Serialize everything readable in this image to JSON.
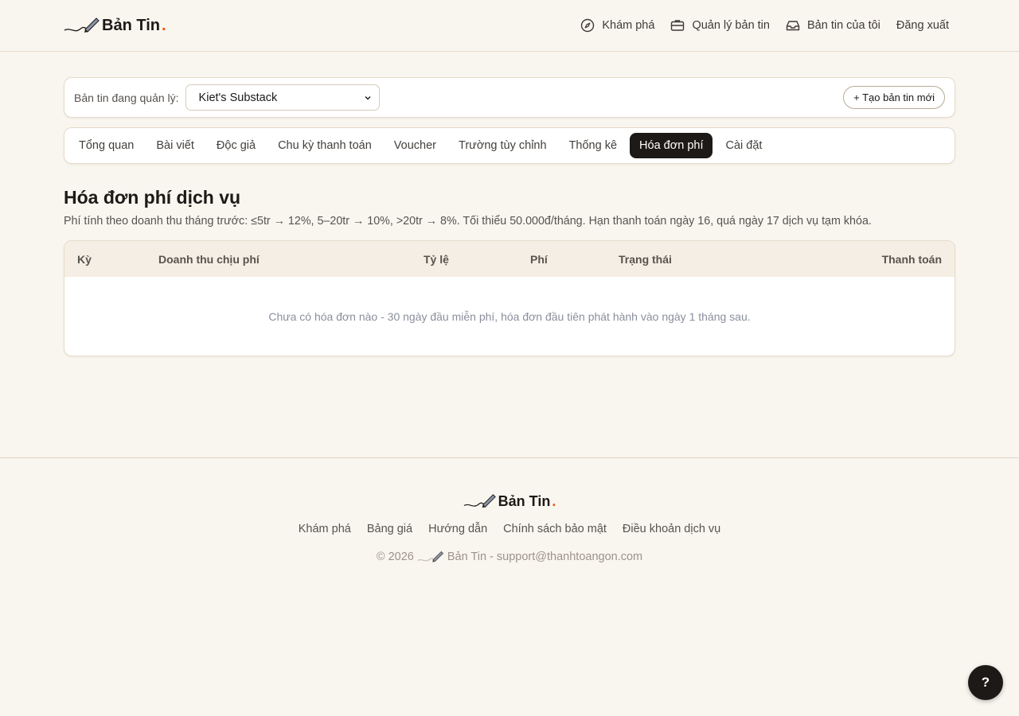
{
  "brand": {
    "name": "Bản Tin",
    "dot": "."
  },
  "header": {
    "nav": [
      {
        "label": "Khám phá",
        "icon": "compass-icon"
      },
      {
        "label": "Quản lý bản tin",
        "icon": "briefcase-icon"
      },
      {
        "label": "Bản tin của tôi",
        "icon": "inbox-icon"
      },
      {
        "label": "Đăng xuất"
      }
    ]
  },
  "selector": {
    "label": "Bản tin đang quản lý:",
    "selected": "Kiet's Substack",
    "create_label": "+ Tạo bản tin mới"
  },
  "tabs": [
    {
      "label": "Tổng quan"
    },
    {
      "label": "Bài viết"
    },
    {
      "label": "Độc giả"
    },
    {
      "label": "Chu kỳ thanh toán"
    },
    {
      "label": "Voucher"
    },
    {
      "label": "Trường tùy chỉnh"
    },
    {
      "label": "Thống kê"
    },
    {
      "label": "Hóa đơn phí",
      "active": true
    },
    {
      "label": "Cài đặt"
    }
  ],
  "main": {
    "title": "Hóa đơn phí dịch vụ",
    "description": "Phí tính theo doanh thu tháng trước: ≤5tr → 12%, 5–20tr → 10%, >20tr → 8%. Tối thiểu 50.000đ/tháng. Hạn thanh toán ngày 16, quá ngày 17 dịch vụ tạm khóa.",
    "table": {
      "columns": [
        "Kỳ",
        "Doanh thu chịu phí",
        "Tỷ lệ",
        "Phí",
        "Trạng thái",
        "Thanh toán"
      ],
      "empty_message": "Chưa có hóa đơn nào - 30 ngày đầu miễn phí, hóa đơn đầu tiên phát hành vào ngày 1 tháng sau."
    }
  },
  "footer": {
    "links": [
      "Khám phá",
      "Bảng giá",
      "Hướng dẫn",
      "Chính sách bảo mật",
      "Điều khoản dịch vụ"
    ],
    "copyright_prefix": "© 2026",
    "copyright_suffix": "Bản Tin - support@thanhtoangon.com"
  },
  "help": {
    "label": "?"
  },
  "colors": {
    "accent": "#ea580c",
    "background": "#f9f5ef",
    "dark": "#1c1917"
  }
}
